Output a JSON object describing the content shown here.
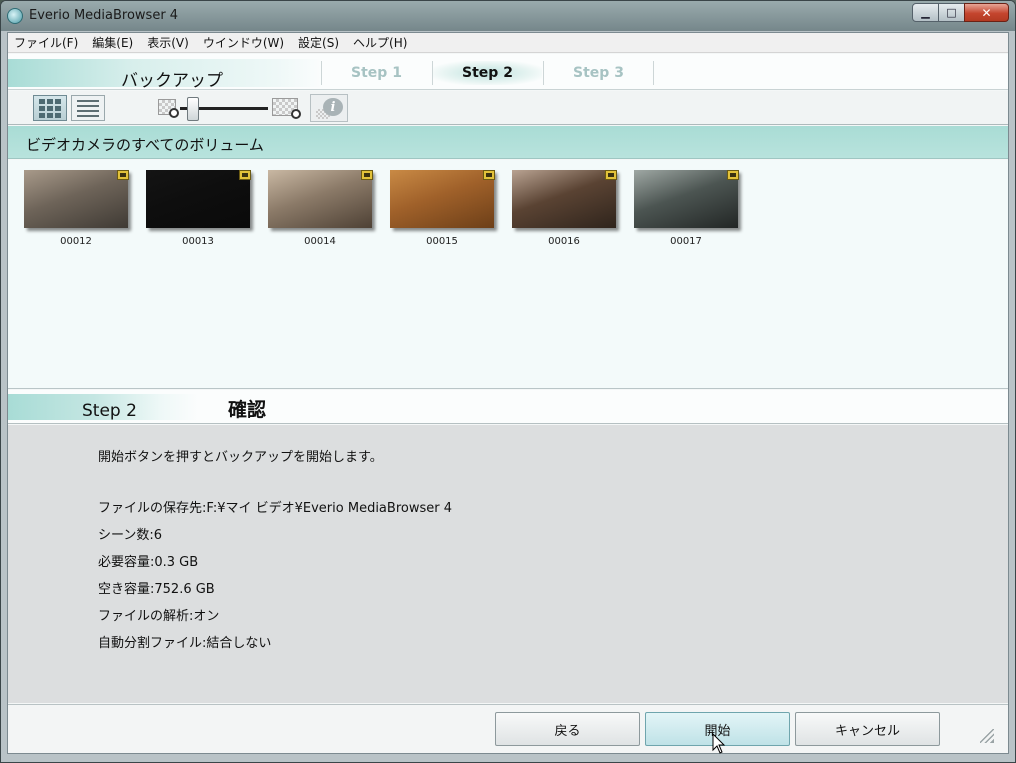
{
  "window": {
    "title": "Everio MediaBrowser 4",
    "controls": {
      "minimize": "▁",
      "maximize": "□",
      "close": "✕"
    }
  },
  "menu": [
    "ファイル(F)",
    "編集(E)",
    "表示(V)",
    "ウインドウ(W)",
    "設定(S)",
    "ヘルプ(H)"
  ],
  "steps": {
    "section_title": "バックアップ",
    "items": [
      {
        "label": "Step 1",
        "state": "inactive"
      },
      {
        "label": "Step 2",
        "state": "active"
      },
      {
        "label": "Step 3",
        "state": "inactive"
      }
    ]
  },
  "toolbar": {
    "icons": [
      "thumbnail-view-icon",
      "list-view-icon",
      "zoom-out-icon",
      "zoom-in-icon",
      "info-icon"
    ],
    "info_label": "i",
    "zoom_level": 0.15
  },
  "volume": {
    "title": "ビデオカメラのすべてのボリューム",
    "clips": [
      {
        "label": "00012",
        "tint": [
          "#6e6459",
          "#a89a8a",
          "#3f3a34"
        ]
      },
      {
        "label": "00013",
        "tint": [
          "#0e0e0e",
          "#141414",
          "#0a0a0a"
        ]
      },
      {
        "label": "00014",
        "tint": [
          "#8b7a68",
          "#c9b8a3",
          "#4e4135"
        ]
      },
      {
        "label": "00015",
        "tint": [
          "#a0612a",
          "#c98a45",
          "#6d3f18"
        ]
      },
      {
        "label": "00016",
        "tint": [
          "#5a4333",
          "#b9a392",
          "#2f241c"
        ]
      },
      {
        "label": "00017",
        "tint": [
          "#4c5552",
          "#9fa8a4",
          "#222625"
        ]
      }
    ]
  },
  "confirm": {
    "step_label": "Step 2",
    "title": "確認",
    "lines": [
      "開始ボタンを押すとバックアップを開始します。",
      "",
      "ファイルの保存先:F:¥マイ ビデオ¥Everio MediaBrowser 4",
      "シーン数:6",
      "必要容量:0.3 GB",
      "空き容量:752.6 GB",
      "ファイルの解析:オン",
      "自動分割ファイル:結合しない"
    ]
  },
  "buttons": {
    "back": "戻る",
    "start": "開始",
    "cancel": "キャンセル"
  },
  "colors": {
    "accent": "#a9dcd5",
    "step_inactive": "#a7c3c3"
  }
}
